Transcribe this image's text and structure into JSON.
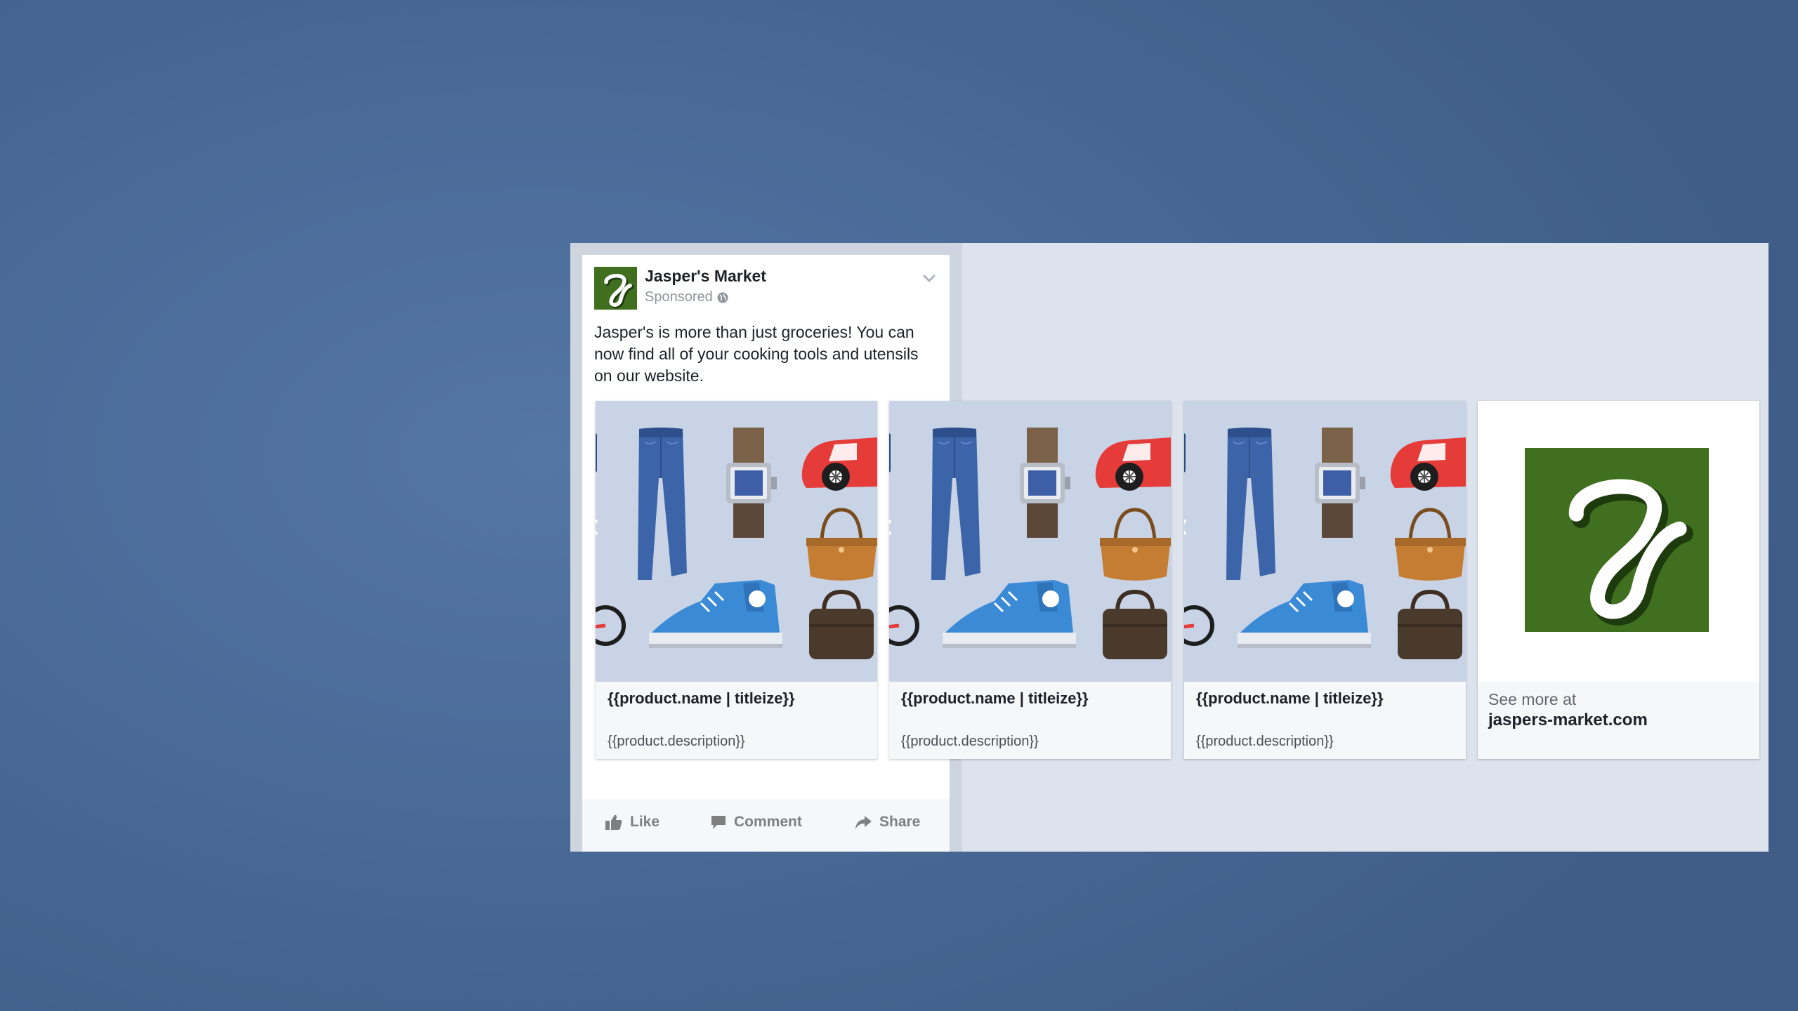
{
  "post": {
    "page_name": "Jasper's Market",
    "sponsored": "Sponsored",
    "text": "Jasper's is more than just groceries! You can now find all of your cooking tools and utensils on our website."
  },
  "carousel": {
    "cards": [
      {
        "title": "{{product.name | titleize}}",
        "description": "{{product.description}}"
      },
      {
        "title": "{{product.name | titleize}}",
        "description": "{{product.description}}"
      },
      {
        "title": "{{product.name | titleize}}",
        "description": "{{product.description}}"
      }
    ],
    "see_more": {
      "label": "See more at",
      "url": "jaspers-market.com"
    }
  },
  "actions": {
    "like": "Like",
    "comment": "Comment",
    "share": "Share"
  },
  "colors": {
    "background": "#4a6b98",
    "brand_green": "#3f6f1f",
    "product_bg": "#c9d3e6",
    "text": "#1d2129"
  },
  "icons": [
    "jasper-logo-icon",
    "globe-icon",
    "chevron-down-icon",
    "thumbs-up-icon",
    "comment-icon",
    "share-icon"
  ]
}
